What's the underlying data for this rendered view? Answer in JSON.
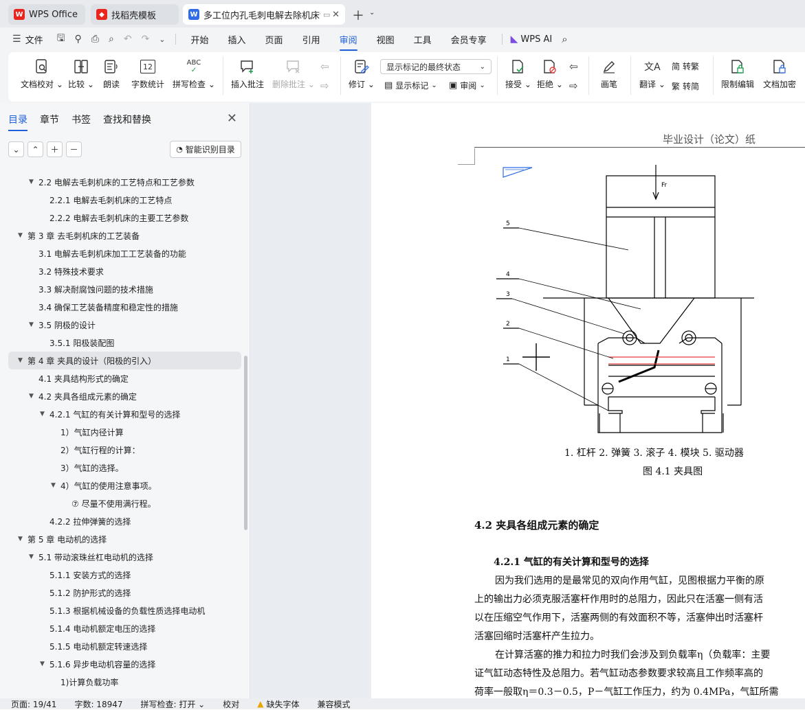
{
  "tabs": [
    {
      "label": "WPS Office",
      "icon": "wps-logo-icon"
    },
    {
      "label": "找稻壳模板",
      "icon": "docer-icon"
    },
    {
      "label": "多工位内孔毛刺电解去除机床t",
      "icon": "word-doc-icon"
    }
  ],
  "menu": {
    "file": "文件",
    "items": [
      "开始",
      "插入",
      "页面",
      "引用",
      "审阅",
      "视图",
      "工具",
      "会员专享"
    ],
    "active": "审阅",
    "ai": "WPS AI"
  },
  "ribbon": {
    "doc_check": "文档校对",
    "compare": "比较",
    "read": "朗读",
    "word_count": "字数统计",
    "word_count_icon_text": "12",
    "spell_check": "拼写检查",
    "spell_icon_text": "ABC",
    "insert_comment": "插入批注",
    "delete_comment": "删除批注",
    "revise": "修订",
    "markup_mode": "显示标记的最终状态",
    "show_markup": "显示标记",
    "review": "审阅",
    "accept": "接受",
    "reject": "拒绝",
    "pen": "画笔",
    "translate": "翻译",
    "to_traditional": "转繁",
    "to_simplified": "转简",
    "restrict_edit": "限制编辑",
    "encrypt": "文档加密"
  },
  "panel": {
    "tabs": [
      "目录",
      "章节",
      "书签",
      "查找和替换"
    ],
    "active_tab": "目录",
    "smart_button": "智能识别目录",
    "toc": [
      {
        "text": "2.2  电解去毛刺机床的工艺特点和工艺参数",
        "level": 2,
        "expand": true
      },
      {
        "text": "2.2.1  电解去毛刺机床的工艺特点",
        "level": 3
      },
      {
        "text": "2.2.2  电解去毛刺机床的主要工艺参数",
        "level": 3
      },
      {
        "text": "第 3 章  去毛刺机床的工艺装备",
        "level": 1,
        "expand": true
      },
      {
        "text": "3.1  电解去毛刺机床加工工艺装备的功能",
        "level": 2
      },
      {
        "text": "3.2  特殊技术要求",
        "level": 2
      },
      {
        "text": "3.3  解决耐腐蚀问题的技术措施",
        "level": 2
      },
      {
        "text": "3.4  确保工艺装备精度和稳定性的措施",
        "level": 2
      },
      {
        "text": "3.5  阴极的设计",
        "level": 2,
        "expand": true
      },
      {
        "text": "3.5.1  阳极装配图",
        "level": 3
      },
      {
        "text": "第 4 章  夹具的设计（阳极的引入）",
        "level": 1,
        "expand": true,
        "selected": true
      },
      {
        "text": "4.1  夹具结构形式的确定",
        "level": 2
      },
      {
        "text": "4.2   夹具各组成元素的确定",
        "level": 2,
        "expand": true
      },
      {
        "text": "4.2.1  气缸的有关计算和型号的选择",
        "level": 3,
        "expand": true
      },
      {
        "text": "1）气缸内径计算",
        "level": 4
      },
      {
        "text": "2）气缸行程的计算：",
        "level": 4
      },
      {
        "text": "3）气缸的选择。",
        "level": 4
      },
      {
        "text": "4）气缸的使用注意事项。",
        "level": 4,
        "expand": true
      },
      {
        "text": "⑦  尽量不使用满行程。",
        "level": 5
      },
      {
        "text": "4.2.2  拉伸弹簧的选择",
        "level": 3
      },
      {
        "text": "第 5 章  电动机的选择",
        "level": 1,
        "expand": true
      },
      {
        "text": "5.1  带动滚珠丝杠电动机的选择",
        "level": 2,
        "expand": true
      },
      {
        "text": "5.1.1  安装方式的选择",
        "level": 3
      },
      {
        "text": "5.1.2  防护形式的选择",
        "level": 3
      },
      {
        "text": "5.1.3  根据机械设备的负载性质选择电动机",
        "level": 3
      },
      {
        "text": "5.1.4  电动机额定电压的选择",
        "level": 3
      },
      {
        "text": "5.1.5  电动机额定转速选择",
        "level": 3
      },
      {
        "text": "5.1.6  异步电动机容量的选择",
        "level": 3,
        "expand": true
      },
      {
        "text": "1)计算负载功率",
        "level": 4
      }
    ]
  },
  "document": {
    "header": "毕业设计（论文）纸",
    "figure_labels": [
      "5",
      "4",
      "3",
      "2",
      "1"
    ],
    "figure_force": "Fr",
    "caption_parts": "1. 杠杆   2. 弹簧   3. 滚子  4. 模块  5. 驱动器",
    "caption_title": "图 4.1  夹具图",
    "section": "4.2    夹具各组成元素的确定",
    "subsection": "4.2.1  气缸的有关计算和型号的选择",
    "para1": [
      "因为我们选用的是最常见的双向作用气缸，见图根据力平衡的原",
      "上的输出力必须克服活塞杆作用时的总阻力，因此只在活塞一侧有活",
      "以在压缩空气作用下，活塞两侧的有效面积不等，活塞伸出时活塞杆",
      "活塞回缩时活塞杆产生拉力。"
    ],
    "para2": [
      "在计算活塞的推力和拉力时我们会涉及到负载率η（负载率：主要",
      "证气缸动态特性及总阻力。若气缸动态参数要求较高且工作频率高的",
      "荷率一般取η＝0.3－0.5，P－气缸工作压力，约为 0.4MPa，气缸所需"
    ]
  },
  "status": {
    "page": "页面: 19/41",
    "words": "字数: 18947",
    "spell": "拼写检查: 打开",
    "proof": "校对",
    "missing_font": "缺失字体",
    "compat": "兼容模式"
  }
}
